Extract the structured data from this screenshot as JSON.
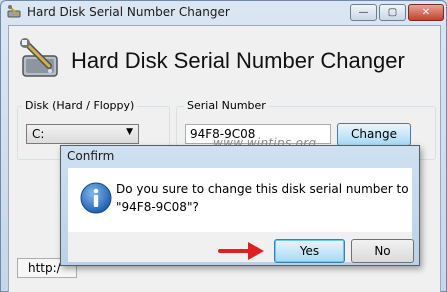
{
  "window": {
    "title": "Hard Disk Serial Number Changer",
    "controls": {
      "minimize": "—",
      "maximize": "▢",
      "close": "✕"
    }
  },
  "app": {
    "heading": "Hard Disk Serial Number Changer",
    "icon": "hard-disk-wrench-icon"
  },
  "disk_group": {
    "label": "Disk (Hard / Floppy)",
    "selected": "C:"
  },
  "serial_group": {
    "label": "Serial Number",
    "value": "94F8-9C08",
    "change_label": "Change"
  },
  "status": {
    "url_text": "http:/"
  },
  "watermark": "www.wintips.org",
  "dialog": {
    "title": "Confirm",
    "icon": "info-icon",
    "message_line1": "Do you sure to change this disk serial number to",
    "message_line2": "\"94F8-9C08\"?",
    "yes_label": "Yes",
    "no_label": "No"
  },
  "colors": {
    "accent": "#3c7fb1",
    "arrow": "#e02020",
    "info_icon": "#1f6fc5"
  }
}
